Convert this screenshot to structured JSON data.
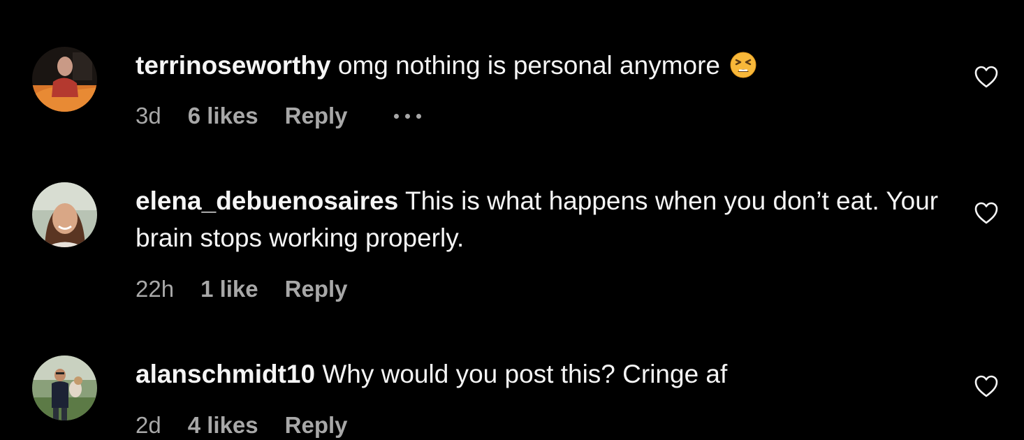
{
  "comments": [
    {
      "username": "terrinoseworthy",
      "text": "omg nothing is personal anymore",
      "emoji": "tired-face-emoji",
      "time": "3d",
      "likes": "6 likes",
      "reply": "Reply"
    },
    {
      "username": "elena_debuenosaires",
      "text": "This is what happens when you don’t eat. Your brain stops working properly.",
      "time": "22h",
      "likes": "1 like",
      "reply": "Reply"
    },
    {
      "username": "alanschmidt10",
      "text": "Why would you post this? Cringe af",
      "time": "2d",
      "likes": "4 likes",
      "reply": "Reply"
    }
  ],
  "colors": {
    "background": "#000000",
    "primary_text": "#f5f5f5",
    "secondary_text": "#a8a8a8"
  }
}
